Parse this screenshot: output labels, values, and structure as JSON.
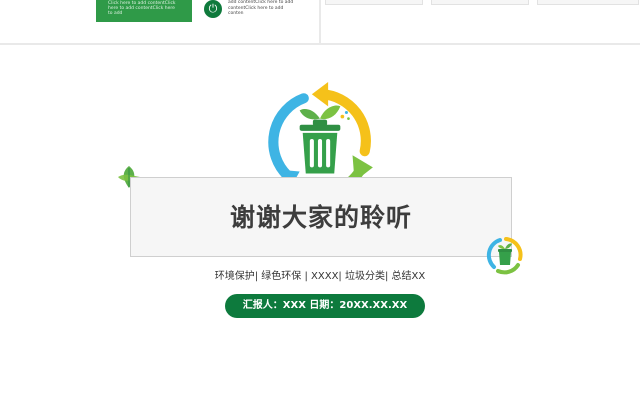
{
  "thumbnail_left": {
    "green_text": "Click here to add contentClick here to add contentClick here to add",
    "side_text": "add contentClick here to add contentClick here to add conten"
  },
  "slide": {
    "title": "谢谢大家的聆听",
    "tags": "环境保护| 绿色环保 | XXXX| 垃圾分类| 总结XX",
    "reporter": "汇报人：XXX  日期：20XX.XX.XX"
  },
  "colors": {
    "brand_green": "#0d7a3d",
    "light_green": "#7cc242",
    "yellow": "#f5c11a",
    "blue": "#3eb4e4",
    "bin_green": "#35a04a"
  },
  "icons": [
    "power-icon",
    "recycle-bin-icon",
    "leaf-icon"
  ]
}
